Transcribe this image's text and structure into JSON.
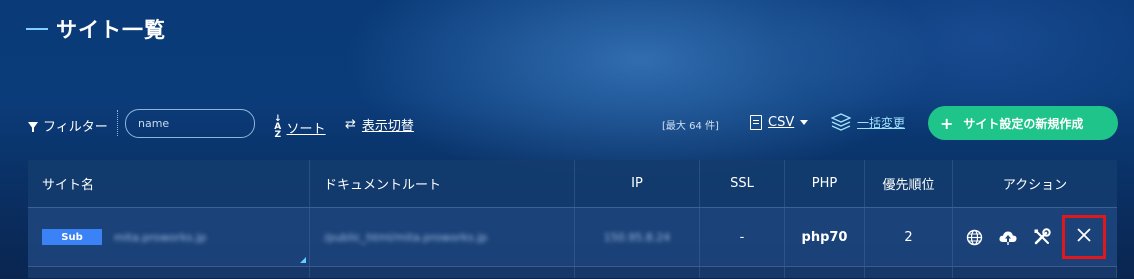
{
  "header": {
    "title": "サイト一覧"
  },
  "toolbar": {
    "filter_label": "フィルター",
    "name_placeholder": "name",
    "sort_label": "ソート",
    "view_toggle_label": "表示切替",
    "max_count": "[最大 64 件]",
    "csv_label": "CSV",
    "bulk_change_label": "一括変更",
    "new_button_label": "サイト設定の新規作成",
    "accent_color": "#1ec48a"
  },
  "table": {
    "columns": [
      "サイト名",
      "ドキュメントルート",
      "IP",
      "SSL",
      "PHP",
      "優先順位",
      "アクション"
    ],
    "rows": [
      {
        "badge": "Sub",
        "site_name": "mita.proworks.jp",
        "doc_root": "/public_html/mita.proworks.jp",
        "ip": "150.95.8.24",
        "ssl": "-",
        "php": "php70",
        "priority": "2",
        "actions": [
          "globe-icon",
          "cloud-upload-icon",
          "tools-icon",
          "close-icon"
        ]
      }
    ],
    "highlight_color": "#e0181c",
    "badge_color": "#3b82f6"
  }
}
